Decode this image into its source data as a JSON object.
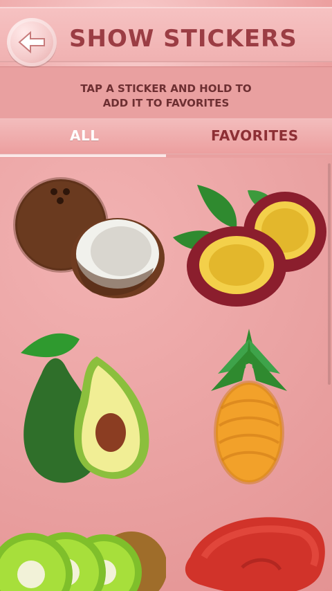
{
  "header": {
    "title": "SHOW STICKERS",
    "subtitle_line1": "TAP A STICKER AND HOLD TO",
    "subtitle_line2": "ADD IT TO FAVORITES"
  },
  "tabs": [
    {
      "label": "ALL",
      "selected": true
    },
    {
      "label": "FAVORITES",
      "selected": false
    }
  ],
  "stickers": [
    {
      "name": "coconut"
    },
    {
      "name": "passion-fruit"
    },
    {
      "name": "avocado"
    },
    {
      "name": "pineapple"
    },
    {
      "name": "kiwi"
    },
    {
      "name": "mango"
    }
  ],
  "colors": {
    "background": "#e9a0a0",
    "title": "#9b3d44",
    "tab_active": "#ffffff",
    "tab_inactive": "#8d2f35"
  }
}
